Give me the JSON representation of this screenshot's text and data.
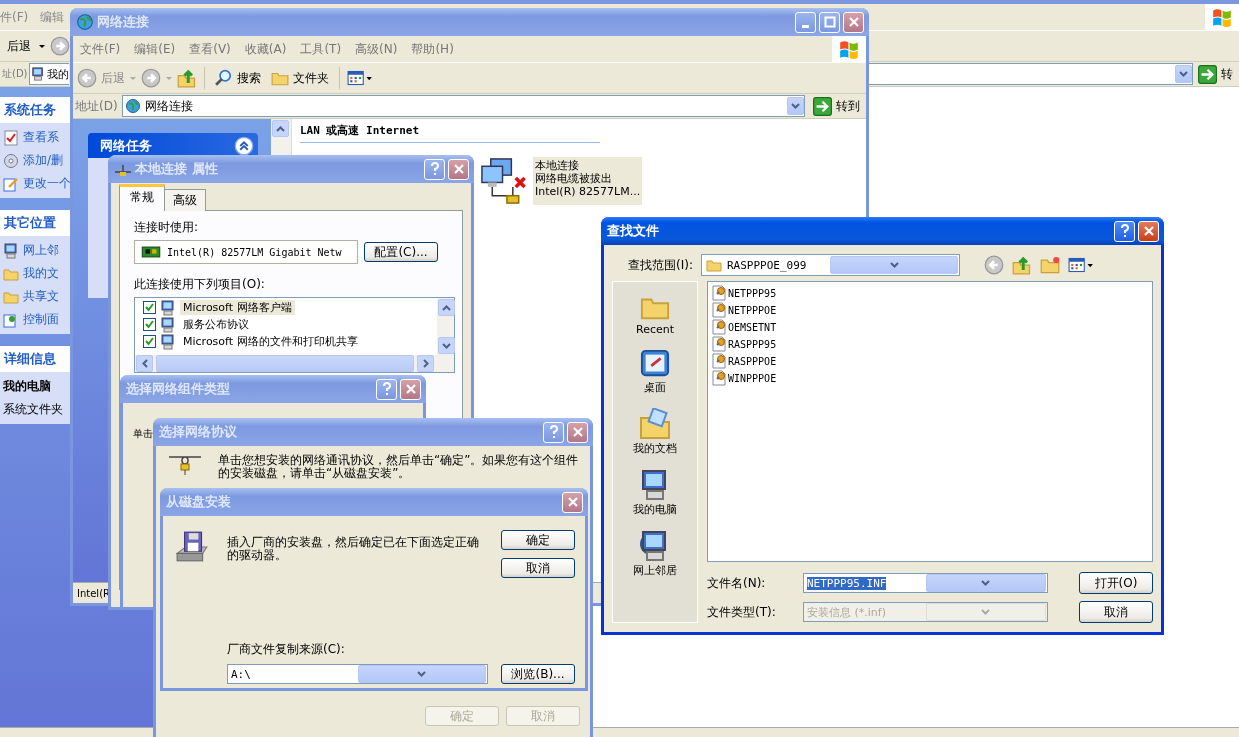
{
  "explorer": {
    "menu": [
      "件(F)",
      "编辑"
    ],
    "back": "后退",
    "address_label": "址(D)",
    "address": "我的",
    "go": "转",
    "panels": [
      {
        "title": "系统任务",
        "items": [
          "查看系",
          "添加/删",
          "更改一个"
        ]
      },
      {
        "title": "其它位置",
        "items": [
          "网上邻",
          "我的文",
          "共享文",
          "控制面"
        ]
      }
    ],
    "details": {
      "title": "详细信息",
      "name": "我的电脑",
      "type": "系统文件夹"
    }
  },
  "network_window": {
    "title": "网络连接",
    "active": false,
    "menu": [
      "文件(F)",
      "编辑(E)",
      "查看(V)",
      "收藏(A)",
      "工具(T)",
      "高级(N)",
      "帮助(H)"
    ],
    "back": "后退",
    "search": "搜索",
    "folders": "文件夹",
    "address_label": "地址(D)",
    "address": "网络连接",
    "go": "转到",
    "task_panel": {
      "title": "网络任务",
      "expanded": true
    },
    "group": "LAN 或高速 Internet",
    "connection": {
      "name": "本地连接",
      "status": "网络电缆被拔出",
      "device": "Intel(R) 82577LM..."
    },
    "status_bar": "Intel(R"
  },
  "properties_dialog": {
    "title": "本地连接 属性",
    "active": false,
    "tabs": [
      {
        "label": "常规",
        "selected": true
      },
      {
        "label": "高级",
        "selected": false
      }
    ],
    "connect_using_label": "连接时使用:",
    "adapter": "Intel(R) 82577LM Gigabit Netw",
    "configure": "配置(C)...",
    "items_label": "此连接使用下列项目(O):",
    "items": [
      {
        "label": "Microsoft 网络客户端",
        "checked": true,
        "selected": true
      },
      {
        "label": "服务公布协议",
        "checked": true,
        "selected": false
      },
      {
        "label": "Microsoft 网络的文件和打印机共享",
        "checked": true,
        "selected": false
      }
    ]
  },
  "component_dialog": {
    "title": "选择网络组件类型",
    "active": false,
    "text": "单击"
  },
  "protocol_dialog": {
    "title": "选择网络协议",
    "active": false,
    "text": "单击您想安装的网络通讯协议，然后单击“确定”。如果您有这个组件的安装磁盘，请单击“从磁盘安装”。",
    "buttons": [
      {
        "label": "确定",
        "disabled": true
      },
      {
        "label": "取消",
        "disabled": true
      }
    ]
  },
  "disk_dialog": {
    "title": "从磁盘安装",
    "active": false,
    "text": "插入厂商的安装盘，然后确定已在下面选定正确的驱动器。",
    "buttons": [
      {
        "label": "确定",
        "disabled": false
      },
      {
        "label": "取消",
        "disabled": false
      }
    ],
    "source_label": "厂商文件复制来源(C):",
    "source": "A:\\",
    "browse": "浏览(B)..."
  },
  "find_dialog": {
    "title": "查找文件",
    "active": true,
    "look_in_label": "查找范围(I):",
    "look_in": "RASPPPOE_099",
    "places": [
      {
        "label": "Recent",
        "kind": "recent"
      },
      {
        "label": "桌面",
        "kind": "desktop"
      },
      {
        "label": "我的文档",
        "kind": "documents"
      },
      {
        "label": "我的电脑",
        "kind": "computer"
      },
      {
        "label": "网上邻居",
        "kind": "network"
      }
    ],
    "files": [
      "NETPPP95",
      "NETPPPOE",
      "OEMSETNT",
      "RASPPP95",
      "RASPPPOE",
      "WINPPPOE"
    ],
    "file_name_label": "文件名(N):",
    "file_name": "NETPPP95.INF",
    "file_type_label": "文件类型(T):",
    "file_type": {
      "value": "安装信息 (*.inf)",
      "disabled": true
    },
    "open": "打开(O)",
    "cancel": "取消"
  }
}
